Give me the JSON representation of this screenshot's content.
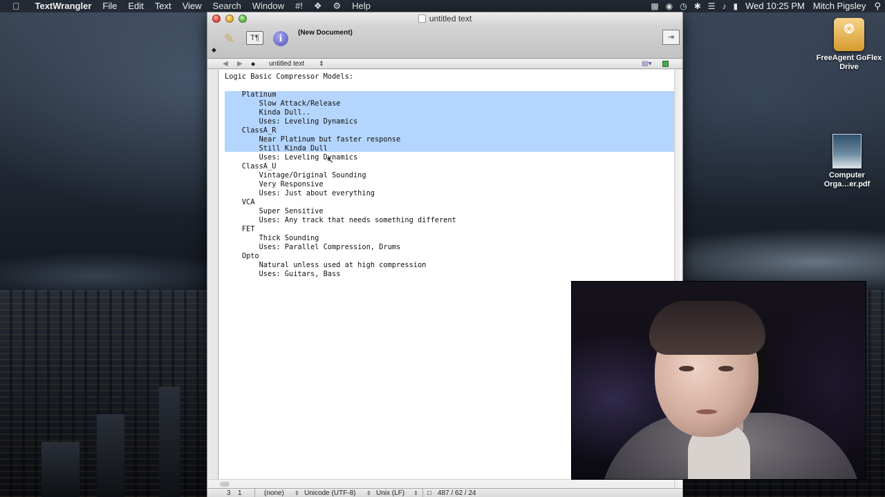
{
  "menubar": {
    "apple_glyph": "",
    "app_name": "TextWrangler",
    "items": [
      "File",
      "Edit",
      "Text",
      "View",
      "Search",
      "Window",
      "#!",
      "Help"
    ],
    "clock": "Wed 10:25 PM",
    "user": "Mitch Pigsley"
  },
  "desktop": {
    "drive_label": "FreeAgent GoFlex Drive",
    "pdf_label_line1": "Computer",
    "pdf_label_line2": "Orga…er.pdf"
  },
  "window": {
    "title": "untitled text",
    "document_status": "(New Document)",
    "navbar_docname": "untitled text"
  },
  "editor": {
    "lines": [
      "Logic Basic Compressor Models:",
      "",
      "    Platinum",
      "        Slow Attack/Release",
      "        Kinda Dull..",
      "        Uses: Leveling Dynamics",
      "    ClassA_R",
      "        Near Platinum but faster response",
      "        Still Kinda Dull",
      "        Uses: Leveling Dynamics",
      "    ClassA_U",
      "        Vintage/Original Sounding",
      "        Very Responsive",
      "        Uses: Just about everything",
      "    VCA",
      "        Super Sensitive",
      "        Uses: Any track that needs something different",
      "    FET",
      "        Thick Sounding",
      "        Uses: Parallel Compression, Drums",
      "    Opto",
      "        Natural unless used at high compression",
      "        Uses: Guitars, Bass"
    ],
    "selected_line_start": 3,
    "selected_line_end": 9
  },
  "statusbar": {
    "line": "3",
    "column": "1",
    "language": "(none)",
    "encoding": "Unicode (UTF-8)",
    "line_endings": "Unix (LF)",
    "counts": "487 / 62 / 24"
  },
  "colors": {
    "selection": "#b4d5fe",
    "close": "#e0443a",
    "minimize": "#e2a92c",
    "zoom": "#5cb542"
  }
}
